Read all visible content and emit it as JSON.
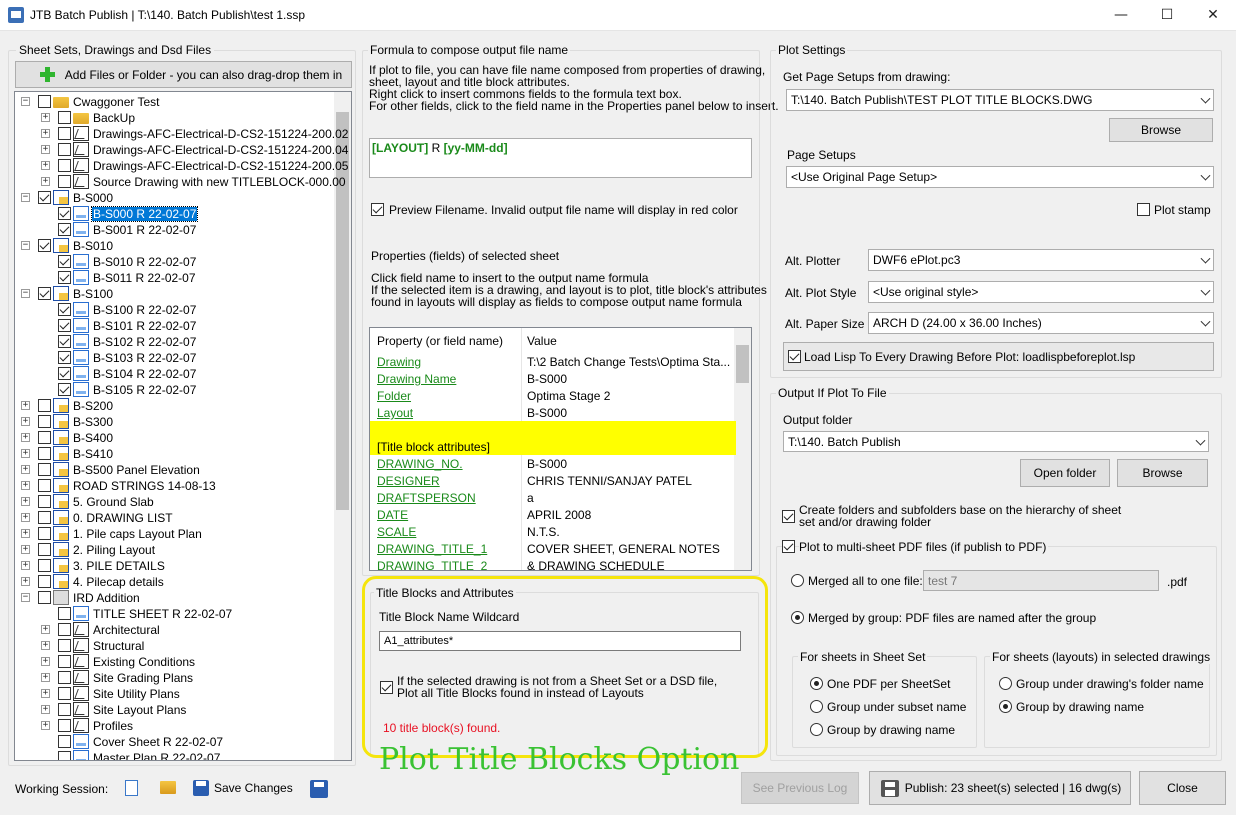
{
  "window": {
    "title": "JTB Batch Publish | T:\\140. Batch Publish\\test 1.ssp"
  },
  "left": {
    "group_title": "Sheet Sets, Drawings  and Dsd Files",
    "add_button": "Add Files or Folder - you can also drag-drop them in",
    "tree": [
      {
        "label": "Cwaggoner Test",
        "level": 0,
        "icon": "folder-icon",
        "checked": false,
        "expander": "-"
      },
      {
        "label": "BackUp",
        "level": 1,
        "icon": "folder-icon",
        "checked": false,
        "expander": "+"
      },
      {
        "label": "Drawings-AFC-Electrical-D-CS2-151224-200.02",
        "level": 1,
        "icon": "drawing-icon",
        "checked": false,
        "expander": "+"
      },
      {
        "label": "Drawings-AFC-Electrical-D-CS2-151224-200.04",
        "level": 1,
        "icon": "drawing-icon",
        "checked": false,
        "expander": "+"
      },
      {
        "label": "Drawings-AFC-Electrical-D-CS2-151224-200.05",
        "level": 1,
        "icon": "drawing-icon",
        "checked": false,
        "expander": "+"
      },
      {
        "label": "Source Drawing with new TITLEBLOCK-000.00",
        "level": 1,
        "icon": "drawing-icon",
        "checked": false,
        "expander": "+"
      },
      {
        "label": "B-S000",
        "level": 0,
        "icon": "sheet-set-icon",
        "checked": true,
        "expander": "-"
      },
      {
        "label": "B-S000 R 22-02-07",
        "level": 1,
        "icon": "sheet-icon",
        "checked": true,
        "expander": "",
        "selected": true
      },
      {
        "label": "B-S001 R 22-02-07",
        "level": 1,
        "icon": "sheet-icon",
        "checked": true,
        "expander": ""
      },
      {
        "label": "B-S010",
        "level": 0,
        "icon": "sheet-set-icon",
        "checked": true,
        "expander": "-"
      },
      {
        "label": "B-S010 R 22-02-07",
        "level": 1,
        "icon": "sheet-icon",
        "checked": true,
        "expander": ""
      },
      {
        "label": "B-S011 R 22-02-07",
        "level": 1,
        "icon": "sheet-icon",
        "checked": true,
        "expander": ""
      },
      {
        "label": "B-S100",
        "level": 0,
        "icon": "sheet-set-icon",
        "checked": true,
        "expander": "-"
      },
      {
        "label": "B-S100 R 22-02-07",
        "level": 1,
        "icon": "sheet-icon",
        "checked": true,
        "expander": ""
      },
      {
        "label": "B-S101 R 22-02-07",
        "level": 1,
        "icon": "sheet-icon",
        "checked": true,
        "expander": ""
      },
      {
        "label": "B-S102 R 22-02-07",
        "level": 1,
        "icon": "sheet-icon",
        "checked": true,
        "expander": ""
      },
      {
        "label": "B-S103 R 22-02-07",
        "level": 1,
        "icon": "sheet-icon",
        "checked": true,
        "expander": ""
      },
      {
        "label": "B-S104 R 22-02-07",
        "level": 1,
        "icon": "sheet-icon",
        "checked": true,
        "expander": ""
      },
      {
        "label": "B-S105 R 22-02-07",
        "level": 1,
        "icon": "sheet-icon",
        "checked": true,
        "expander": ""
      },
      {
        "label": "B-S200",
        "level": 0,
        "icon": "sheet-set-icon",
        "checked": false,
        "expander": "+"
      },
      {
        "label": "B-S300",
        "level": 0,
        "icon": "sheet-set-icon",
        "checked": false,
        "expander": "+"
      },
      {
        "label": "B-S400",
        "level": 0,
        "icon": "sheet-set-icon",
        "checked": false,
        "expander": "+"
      },
      {
        "label": "B-S410",
        "level": 0,
        "icon": "sheet-set-icon",
        "checked": false,
        "expander": "+"
      },
      {
        "label": "B-S500 Panel Elevation",
        "level": 0,
        "icon": "sheet-set-icon",
        "checked": false,
        "expander": "+"
      },
      {
        "label": "ROAD STRINGS 14-08-13",
        "level": 0,
        "icon": "sheet-set-icon",
        "checked": false,
        "expander": "+"
      },
      {
        "label": "5. Ground Slab",
        "level": 0,
        "icon": "sheet-set-icon",
        "checked": false,
        "expander": "+"
      },
      {
        "label": "0. DRAWING LIST",
        "level": 0,
        "icon": "sheet-set-icon",
        "checked": false,
        "expander": "+"
      },
      {
        "label": "1. Pile caps Layout Plan",
        "level": 0,
        "icon": "sheet-set-icon",
        "checked": false,
        "expander": "+"
      },
      {
        "label": "2. Piling Layout",
        "level": 0,
        "icon": "sheet-set-icon",
        "checked": false,
        "expander": "+"
      },
      {
        "label": "3. PILE DETAILS",
        "level": 0,
        "icon": "sheet-set-icon",
        "checked": false,
        "expander": "+"
      },
      {
        "label": "4. Pilecap details",
        "level": 0,
        "icon": "sheet-set-icon",
        "checked": false,
        "expander": "+"
      },
      {
        "label": "IRD Addition",
        "level": 0,
        "icon": "ird-icon",
        "checked": false,
        "expander": "-"
      },
      {
        "label": "TITLE SHEET R 22-02-07",
        "level": 1,
        "icon": "sheet-icon",
        "checked": false,
        "expander": ""
      },
      {
        "label": "Architectural",
        "level": 1,
        "icon": "drawing-icon",
        "checked": false,
        "expander": "+"
      },
      {
        "label": "Structural",
        "level": 1,
        "icon": "drawing-icon",
        "checked": false,
        "expander": "+"
      },
      {
        "label": "Existing Conditions",
        "level": 1,
        "icon": "drawing-icon",
        "checked": false,
        "expander": "+"
      },
      {
        "label": "Site Grading Plans",
        "level": 1,
        "icon": "drawing-icon",
        "checked": false,
        "expander": "+"
      },
      {
        "label": "Site Utility Plans",
        "level": 1,
        "icon": "drawing-icon",
        "checked": false,
        "expander": "+"
      },
      {
        "label": "Site Layout Plans",
        "level": 1,
        "icon": "drawing-icon",
        "checked": false,
        "expander": "+"
      },
      {
        "label": "Profiles",
        "level": 1,
        "icon": "drawing-icon",
        "checked": false,
        "expander": "+"
      },
      {
        "label": "Cover Sheet R 22-02-07",
        "level": 1,
        "icon": "sheet-icon",
        "checked": false,
        "expander": ""
      },
      {
        "label": "Master Plan R 22-02-07",
        "level": 1,
        "icon": "sheet-icon",
        "checked": false,
        "expander": ""
      }
    ]
  },
  "middle": {
    "formula_group_title": "Formula to compose output file name",
    "formula_help": [
      "If plot to file, you can have file name composed from properties of drawing,",
      "sheet, layout and title block attributes.",
      "Right click to insert commons fields to the formula text box.",
      "For other fields, click to the field name in the Properties panel below to insert."
    ],
    "formula_tokens": [
      "[LAYOUT]",
      " R ",
      "[yy-MM-dd]"
    ],
    "preview_label": "Preview Filename. Invalid output file name will display in red color",
    "preview_checked": true,
    "properties_title": "Properties (fields) of selected sheet",
    "properties_help": [
      "Click field name to insert to the output name formula",
      "If the selected item is a drawing, and layout is to plot, title block's attributes",
      "found in layouts will display as fields to compose output name formula"
    ],
    "table_headers": [
      "Property (or field name)",
      "Value"
    ],
    "table_rows": [
      {
        "k": "Drawing",
        "v": "T:\\2 Batch Change Tests\\Optima Sta..."
      },
      {
        "k": "Drawing Name",
        "v": "B-S000"
      },
      {
        "k": "Folder",
        "v": "Optima Stage 2"
      },
      {
        "k": "Layout",
        "v": "B-S000"
      },
      {
        "k": "",
        "v": "",
        "hl": true
      },
      {
        "k": "[Title block attributes]",
        "v": "",
        "hl": true
      },
      {
        "k": "DRAWING_NO.",
        "v": "B-S000"
      },
      {
        "k": "DESIGNER",
        "v": "CHRIS TENNI/SANJAY PATEL"
      },
      {
        "k": "DRAFTSPERSON",
        "v": "a"
      },
      {
        "k": "DATE",
        "v": "APRIL 2008"
      },
      {
        "k": "SCALE",
        "v": "N.T.S."
      },
      {
        "k": "DRAWING_TITLE_1",
        "v": "COVER SHEET, GENERAL NOTES"
      },
      {
        "k": "DRAWING_TITLE_2",
        "v": "& DRAWING SCHEDULE"
      }
    ],
    "tb_group_title": "Title Blocks and Attributes",
    "tb_wildcard_label": "Title Block Name Wildcard",
    "tb_wildcard_value": "A1_attributes*",
    "tb_option_line1": "If the selected drawing is not from a Sheet Set or a DSD file,",
    "tb_option_line2": "Plot all Title Blocks found in instead of Layouts",
    "tb_option_checked": true,
    "tb_found": "10 title block(s) found.",
    "annotation": "Plot Title Blocks Option"
  },
  "right": {
    "plot_settings_title": "Plot Settings",
    "page_setups_from_label": "Get Page Setups from drawing:",
    "page_setups_from_value": "T:\\140. Batch Publish\\TEST PLOT TITLE BLOCKS.DWG",
    "browse": "Browse",
    "page_setups_label": "Page Setups",
    "page_setups_value": "<Use Original Page Setup>",
    "plot_stamp": "Plot stamp",
    "alt_plotter_label": "Alt. Plotter",
    "alt_plotter_value": "DWF6 ePlot.pc3",
    "alt_style_label": "Alt. Plot Style",
    "alt_style_value": "<Use original style>",
    "alt_paper_label": "Alt. Paper Size",
    "alt_paper_value": "ARCH D (24.00 x 36.00 Inches)",
    "load_lisp_label": "Load Lisp To Every Drawing Before Plot: loadlispbeforeplot.lsp",
    "output_title": "Output If Plot To File",
    "output_folder_label": "Output folder",
    "output_folder_value": "T:\\140. Batch Publish",
    "open_folder": "Open folder",
    "browse2": "Browse",
    "create_folders_line1": "Create folders and subfolders base on the hierarchy of sheet",
    "create_folders_line2": "set and/or drawing folder",
    "multi_pdf": "Plot to multi-sheet PDF files (if publish to PDF)",
    "merged_all": "Merged all to one file:",
    "merged_all_value": "test 7",
    "pdf_ext": ".pdf",
    "merged_group": "Merged by group: PDF files are named after the group",
    "sheetset_group_title": "For sheets in Sheet Set",
    "ss_opt1": "One PDF per SheetSet",
    "ss_opt2": "Group under subset name",
    "ss_opt3": "Group by drawing name",
    "dwg_group_title": "For sheets (layouts) in selected drawings",
    "dw_opt1": "Group under drawing's folder name",
    "dw_opt2": "Group by drawing name"
  },
  "footer": {
    "working_session": "Working Session:",
    "save_changes": "Save Changes",
    "see_previous_log": "See Previous Log",
    "publish": "Publish: 23 sheet(s) selected | 16 dwg(s)",
    "close": "Close"
  },
  "colors": {
    "accent": "#0078d7",
    "link_green": "#1a8a1a",
    "highlight": "#ffff00",
    "annotation": "#3ac234",
    "annotation_box": "#f5e50c",
    "error_red": "#e81123"
  }
}
